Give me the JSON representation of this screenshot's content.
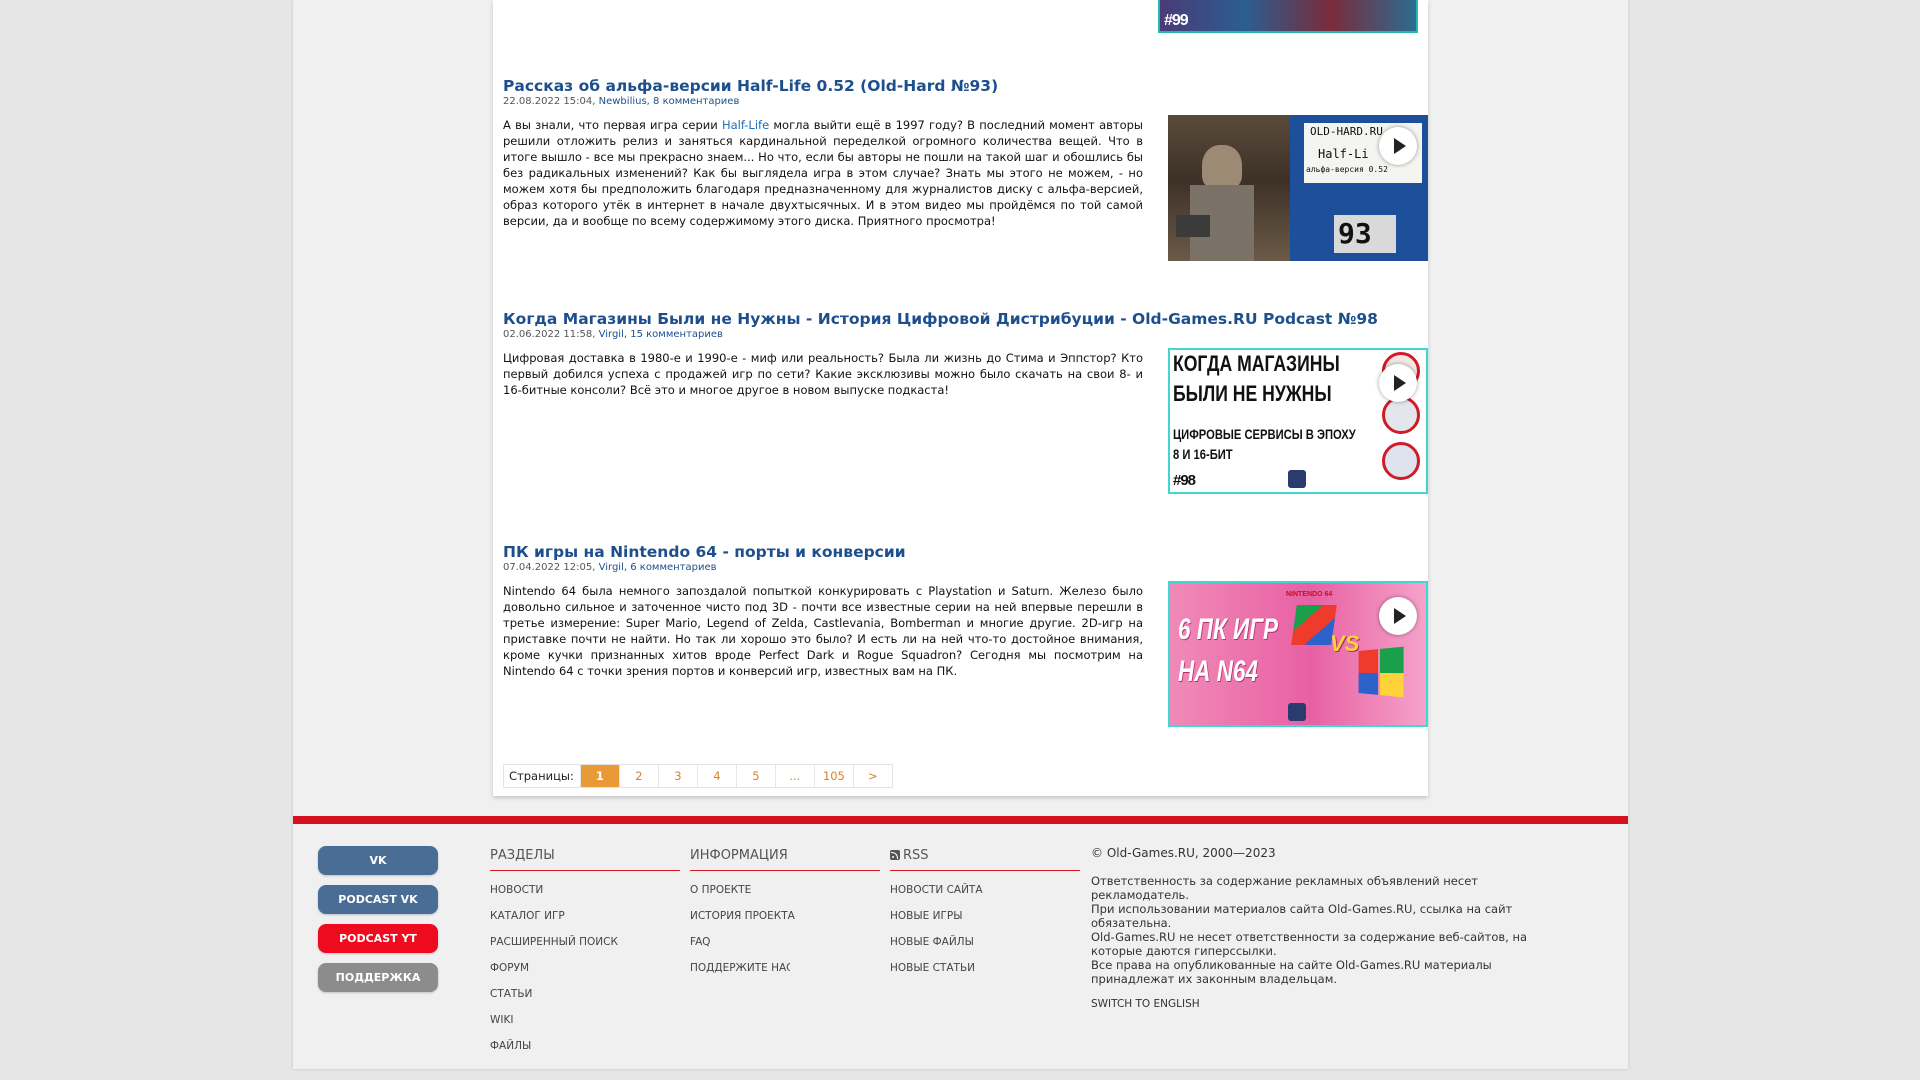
{
  "articles": [
    {
      "title": "Рассказ об альфа-версии Half-Life 0.52 (Old-Hard №93)",
      "date": "22.08.2022 15:04, ",
      "author": "Newbilius",
      "comments": ", 8 комментариев",
      "body_pre": "А вы знали, что первая игра серии ",
      "body_link": "Half-Life",
      "body_post": " могла выйти ещё в 1997 году? В последний момент авторы решили отложить релиз и заняться кардинальной переделкой огромного количества вещей. Что в итоге вышло - все мы прекрасно знаем... Но что, если бы авторы не пошли на такой шаг и обошлись бы без радикальных изменений? Как бы выглядела игра в этом случае? Знать мы этого не можем, - но можем хотя бы предположить благодаря предназначенному для журналистов диску с альфа-версией, образ которого утёк в интернет в начале двухтысячных. И в этом видео мы пройдёмся по той самой версии, да и вообще по всему содержимому этого диска. Приятного просмотра!",
      "thumb": {
        "line1": "OLD-HARD.RU",
        "line2": "Half-Li",
        "line3": "альфа-версия 0.52",
        "number": "93"
      }
    },
    {
      "title": "Когда Магазины Были не Нужны - История Цифровой Дистрибуции - Old-Games.RU Podcast №98",
      "date": "02.06.2022 11:58, ",
      "author": "Virgil",
      "comments": ", 15 комментариев",
      "body": "Цифровая доставка в 1980-е и 1990-е - миф или реальность? Была ли жизнь до Стима и Эппстор? Кто первый добился успеха с продажей игр по сети? Какие эксклюзивы можно было скачать на свои 8- и 16-битные консоли? Всё это и многое другое в новом выпуске подкаста!",
      "thumb": {
        "line1": "КОГДА МАГАЗИНЫ",
        "line2": "БЫЛИ НЕ НУЖНЫ",
        "line3": "ЦИФРОВЫЕ СЕРВИСЫ В ЭПОХУ",
        "line4": "8 И 16-БИТ",
        "number": "#98"
      }
    },
    {
      "title": "ПК игры на Nintendo 64 - порты и конверсии",
      "date": "07.04.2022 12:05, ",
      "author": "Virgil",
      "comments": ", 6 комментариев",
      "body": "Nintendo 64 была немного запоздалой попыткой конкурировать с Playstation и Saturn. Железо было довольно сильное и заточенное чисто под 3D - почти все известные серии на ней впервые перешли в третье измерение: Super Mario, Legend of Zelda, Castlevania, Bomberman и многие другие. 2D-игр на приставке почти не найти. Но так ли хорошо это было? И есть ли на ней что-то достойное внимания, кроме кучки признанных хитов вроде Perfect Dark и Rogue Squadron? Сегодня мы посмотрим на Nintendo 64 с точки зрения портов и конверсий игр, известных вам на ПК.",
      "thumb": {
        "line1": "6 ПК ИГР",
        "line2": "НА N64",
        "brand": "NINTENDO 64",
        "vs": "VS"
      }
    }
  ],
  "top_thumb": {
    "number": "#99"
  },
  "pager": {
    "label": "Страницы:",
    "items": [
      "1",
      "2",
      "3",
      "4",
      "5",
      "...",
      "105",
      ">"
    ]
  },
  "footer": {
    "buttons": [
      {
        "label": "VK",
        "color": "#4a6d96"
      },
      {
        "label": "PODCAST VK",
        "color": "#4a6d96"
      },
      {
        "label": "PODCAST YT",
        "color": "#ee0b1f"
      },
      {
        "label": "ПОДДЕРЖКА",
        "color": "#8c8c8c"
      }
    ],
    "sections": {
      "head": "РАЗДЕЛЫ",
      "links": [
        "НОВОСТИ",
        "КАТАЛОГ ИГР",
        "РАСШИРЕННЫЙ ПОИСК",
        "ФОРУМ",
        "СТАТЬИ",
        "WIKI",
        "ФАЙЛЫ"
      ]
    },
    "info": {
      "head": "ИНФОРМАЦИЯ",
      "links": [
        "О ПРОЕКТЕ",
        "ИСТОРИЯ ПРОЕКТА",
        "FAQ",
        "ПОДДЕРЖИТЕ НАС!"
      ]
    },
    "rss": {
      "head": "RSS",
      "links": [
        "НОВОСТИ САЙТА",
        "НОВЫЕ ИГРЫ",
        "НОВЫЕ ФАЙЛЫ",
        "НОВЫЕ СТАТЬИ"
      ]
    },
    "copyright": "© Old-Games.RU, 2000—2023",
    "legal": [
      "Ответственность за содержание рекламных объявлений несет рекламодатель.",
      "При использовании материалов сайта Old-Games.RU, ссылка на сайт обязательна.",
      "Old-Games.RU не несет ответственности за содержание веб-сайтов, на которые даются гиперссылки.",
      "Все права на опубликованные на сайте Old-Games.RU материалы принадлежат их законным владельцам."
    ],
    "switch_lang": "SWITCH TO ENGLISH"
  },
  "colors": {
    "accent_red": "#d6111f",
    "link_blue": "#1d4f8c",
    "pager_orange": "#e99a36"
  }
}
